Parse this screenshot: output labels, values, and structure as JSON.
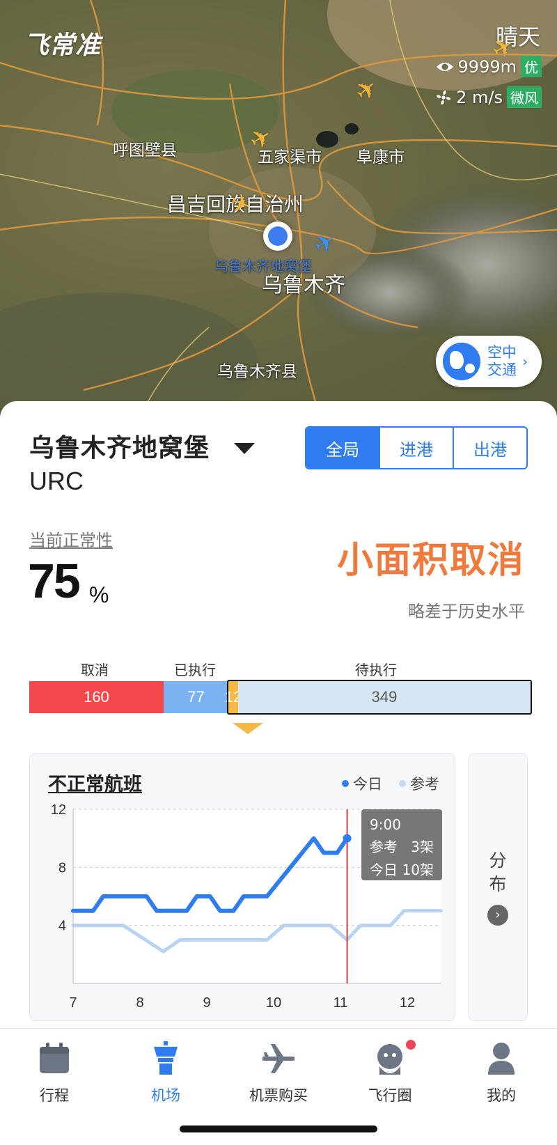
{
  "app": {
    "brand": "飞常准"
  },
  "weather": {
    "condition": "晴天",
    "visibility": "9999m",
    "visibility_rating": "优",
    "wind_speed": "2 m/s",
    "wind_level": "微风"
  },
  "map": {
    "labels": [
      "呼图壁县",
      "五家渠市",
      "阜康市",
      "昌吉回族自治州",
      "乌鲁木齐",
      "乌鲁木齐县",
      "乌鲁木齐地窝堡"
    ],
    "traffic_button": "空中交通"
  },
  "airport": {
    "name": "乌鲁木齐地窝堡",
    "code": "URC",
    "tabs": [
      {
        "label": "全局",
        "active": true
      },
      {
        "label": "进港",
        "active": false
      },
      {
        "label": "出港",
        "active": false
      }
    ]
  },
  "punctuality": {
    "label": "当前正常性",
    "value": "75",
    "unit": "%",
    "status": "小面积取消",
    "status_note": "略差于历史水平"
  },
  "flights_bar": {
    "captions": [
      "取消",
      "已执行",
      "待执行"
    ],
    "segments": [
      {
        "label": "160",
        "value": 160,
        "color": "#f2484c"
      },
      {
        "label": "77",
        "value": 77,
        "color": "#7ab3f0"
      },
      {
        "label": "12",
        "value": 12,
        "color": "#f3b845"
      },
      {
        "label": "349",
        "value": 349,
        "color": "#d6e6f5"
      }
    ]
  },
  "chart_data": {
    "type": "line",
    "title": "不正常航班",
    "legend": [
      {
        "name": "今日",
        "color": "#2e7cf0"
      },
      {
        "name": "参考",
        "color": "#b7d3f3"
      }
    ],
    "xlim": [
      7,
      12.5
    ],
    "ylim": [
      0,
      12
    ],
    "x_ticks": [
      "7",
      "8",
      "9",
      "10",
      "11",
      "12"
    ],
    "y_ticks": [
      "12",
      "8",
      "4"
    ],
    "series": [
      {
        "name": "今日",
        "x": [
          7,
          7.3,
          7.45,
          8.1,
          8.25,
          8.7,
          8.85,
          9.05,
          9.2,
          9.4,
          9.55,
          9.9,
          10.6,
          10.75,
          10.95,
          11.1
        ],
        "y": [
          5,
          5,
          6,
          6,
          5,
          5,
          6,
          6,
          5,
          5,
          6,
          6,
          10,
          9,
          9,
          10
        ]
      },
      {
        "name": "参考",
        "x": [
          7,
          7.75,
          8.35,
          8.6,
          9.9,
          10.15,
          10.85,
          11.1,
          11.3,
          11.75,
          11.95,
          12.5
        ],
        "y": [
          4,
          4,
          2.2,
          3,
          3,
          4,
          4,
          3,
          4,
          4,
          5,
          5
        ]
      }
    ],
    "tooltip": {
      "time": "9:00",
      "rows": [
        {
          "name": "参考",
          "value": "3架"
        },
        {
          "name": "今日",
          "value": "10架"
        }
      ]
    },
    "cursor_x": 11.1
  },
  "side_panel": {
    "label": "分布"
  },
  "tabbar": [
    {
      "label": "行程",
      "icon": "calendar-icon",
      "active": false
    },
    {
      "label": "机场",
      "icon": "control-tower-icon",
      "active": true
    },
    {
      "label": "机票购买",
      "icon": "airplane-icon",
      "active": false
    },
    {
      "label": "飞行圈",
      "icon": "community-icon",
      "active": false,
      "badge": true
    },
    {
      "label": "我的",
      "icon": "profile-icon",
      "active": false
    }
  ]
}
